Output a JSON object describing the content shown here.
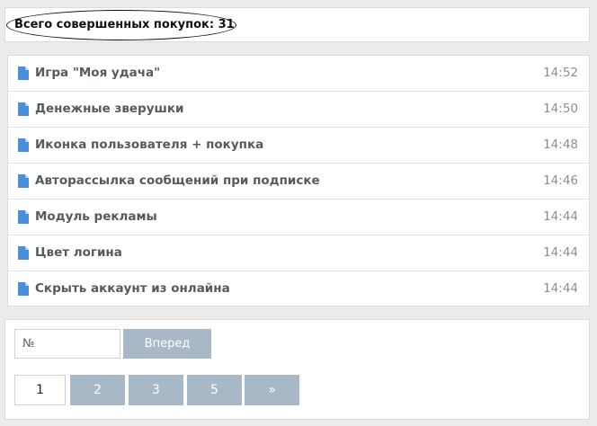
{
  "header": {
    "text": "Всего совершенных покупок: 31"
  },
  "purchases": [
    {
      "title": "Игра \"Моя удача\"",
      "time": "14:52"
    },
    {
      "title": "Денежные зверушки",
      "time": "14:50"
    },
    {
      "title": "Иконка пользователя + покупка",
      "time": "14:48"
    },
    {
      "title": "Авторассылка сообщений при подписке",
      "time": "14:46"
    },
    {
      "title": "Модуль рекламы",
      "time": "14:44"
    },
    {
      "title": "Цвет логина",
      "time": "14:44"
    },
    {
      "title": "Скрыть аккаунт из онлайна",
      "time": "14:44"
    }
  ],
  "pager": {
    "input_placeholder": "№",
    "go_label": "Вперед",
    "pages": [
      "1",
      "2",
      "3",
      "5"
    ],
    "current_page": "1",
    "next_label": "»"
  },
  "colors": {
    "icon": "#4a90d9",
    "button": "#a8b8c6"
  }
}
